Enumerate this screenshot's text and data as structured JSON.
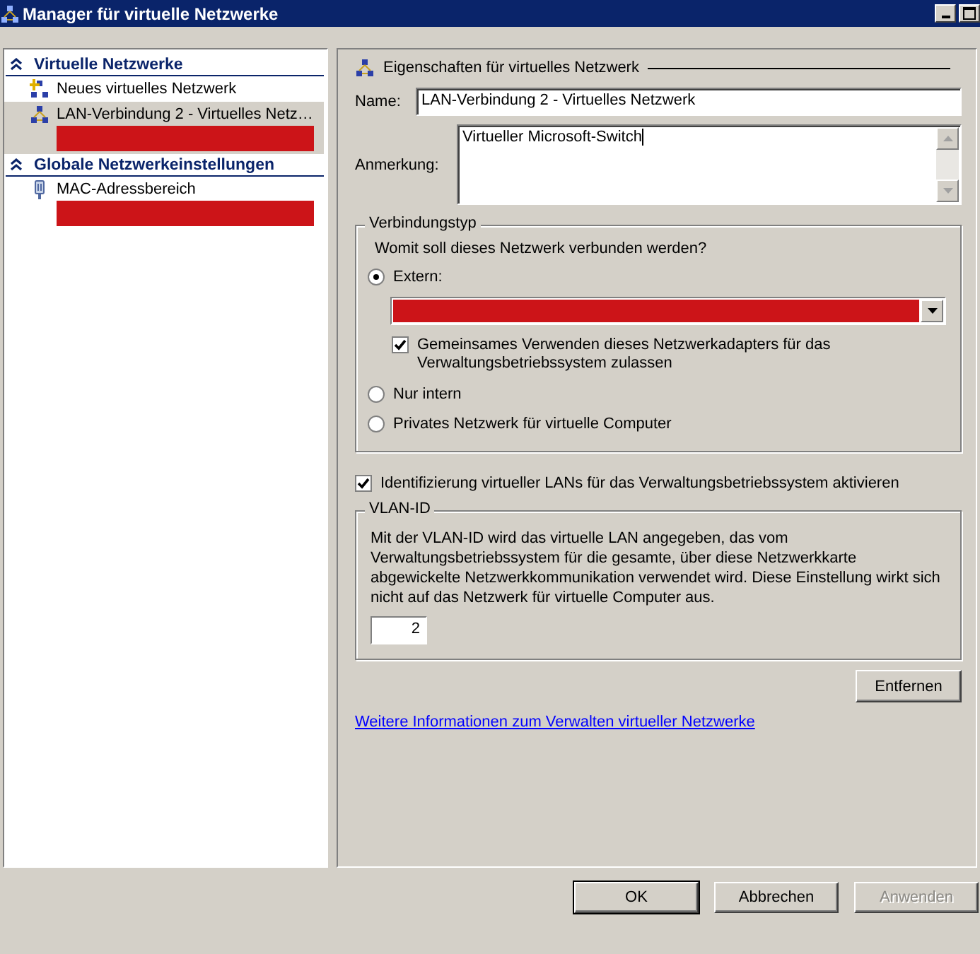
{
  "window": {
    "title": "Manager für virtuelle Netzwerke"
  },
  "sidebar": {
    "sections": [
      {
        "title": "Virtuelle Netzwerke",
        "expanded": true,
        "items": [
          {
            "label": "Neues virtuelles Netzwerk",
            "kind": "action",
            "selected": false,
            "redacted": false
          },
          {
            "label": "LAN-Verbindung 2 - Virtuelles Netz…",
            "kind": "network",
            "selected": true,
            "redacted": true
          }
        ]
      },
      {
        "title": "Globale Netzwerkeinstellungen",
        "expanded": true,
        "items": [
          {
            "label": "MAC-Adressbereich",
            "kind": "setting",
            "selected": false,
            "redacted": true
          }
        ]
      }
    ]
  },
  "details": {
    "heading": "Eigenschaften für virtuelles Netzwerk",
    "name": {
      "label": "Name:",
      "value": "LAN-Verbindung 2 - Virtuelles Netzwerk"
    },
    "note": {
      "label": "Anmerkung:",
      "value": "Virtueller Microsoft-Switch"
    },
    "connection_type": {
      "legend": "Verbindungstyp",
      "question": "Womit soll dieses Netzwerk verbunden werden?",
      "options": [
        {
          "label": "Extern:",
          "selected": true
        },
        {
          "label": "Nur intern",
          "selected": false
        },
        {
          "label": "Privates Netzwerk für virtuelle Computer",
          "selected": false
        }
      ],
      "adapter": {
        "redacted": true
      },
      "share": {
        "label": "Gemeinsames Verwenden dieses Netzwerkadapters für das Verwaltungsbetriebssystem zulassen",
        "checked": true
      }
    },
    "vlan_enable": {
      "label": "Identifizierung virtueller LANs für das Verwaltungsbetriebssystem aktivieren",
      "checked": true
    },
    "vlan": {
      "legend": "VLAN-ID",
      "description": "Mit der VLAN-ID wird das virtuelle LAN angegeben, das vom Verwaltungsbetriebssystem für die gesamte, über diese Netzwerkkarte abgewickelte Netzwerkkommunikation verwendet wird. Diese Einstellung wirkt sich nicht auf das Netzwerk für virtuelle Computer aus.",
      "value": "2"
    },
    "remove_button": "Entfernen",
    "link": "Weitere Informationen zum Verwalten virtueller Netzwerke"
  },
  "buttons": [
    {
      "label": "OK",
      "disabled": false,
      "default": true
    },
    {
      "label": "Abbrechen",
      "disabled": false,
      "default": false
    },
    {
      "label": "Anwenden",
      "disabled": true,
      "default": false
    }
  ]
}
